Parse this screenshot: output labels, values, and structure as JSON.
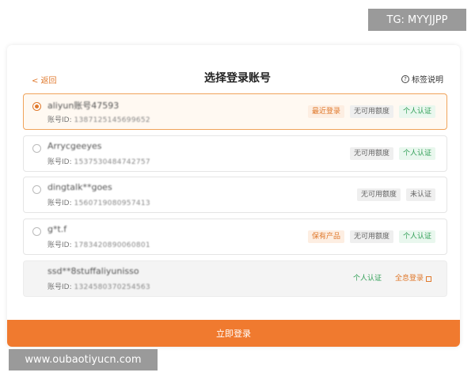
{
  "header": {
    "back_label": "< 返回",
    "title": "选择登录账号",
    "help_label": "标签说明"
  },
  "id_label": "账号ID:",
  "accounts": [
    {
      "name": "aliyun账号47593",
      "id": "1387125145699652",
      "selected": true,
      "tags": [
        "最近登录",
        "无可用额度",
        "个人认证"
      ]
    },
    {
      "name": "Arrycgeeyes",
      "id": "1537530484742757",
      "selected": false,
      "tags": [
        "无可用额度",
        "个人认证"
      ]
    },
    {
      "name": "dingtalk**goes",
      "id": "1560719080957413",
      "selected": false,
      "tags": [
        "无可用额度",
        "未认证"
      ]
    },
    {
      "name": "g*t.f",
      "id": "1783420890060801",
      "selected": false,
      "tags": [
        "保有产品",
        "无可用额度",
        "个人认证"
      ]
    },
    {
      "name": "ssd**8stuffaliyunisso",
      "id": "1324580370254563",
      "selected": false,
      "tags": [
        "个人认证"
      ],
      "link": "全息登录"
    }
  ],
  "login_button": "立即登录",
  "watermarks": {
    "top": "TG: MYYJJPP",
    "bottom": "www.oubaotiyucn.com"
  }
}
